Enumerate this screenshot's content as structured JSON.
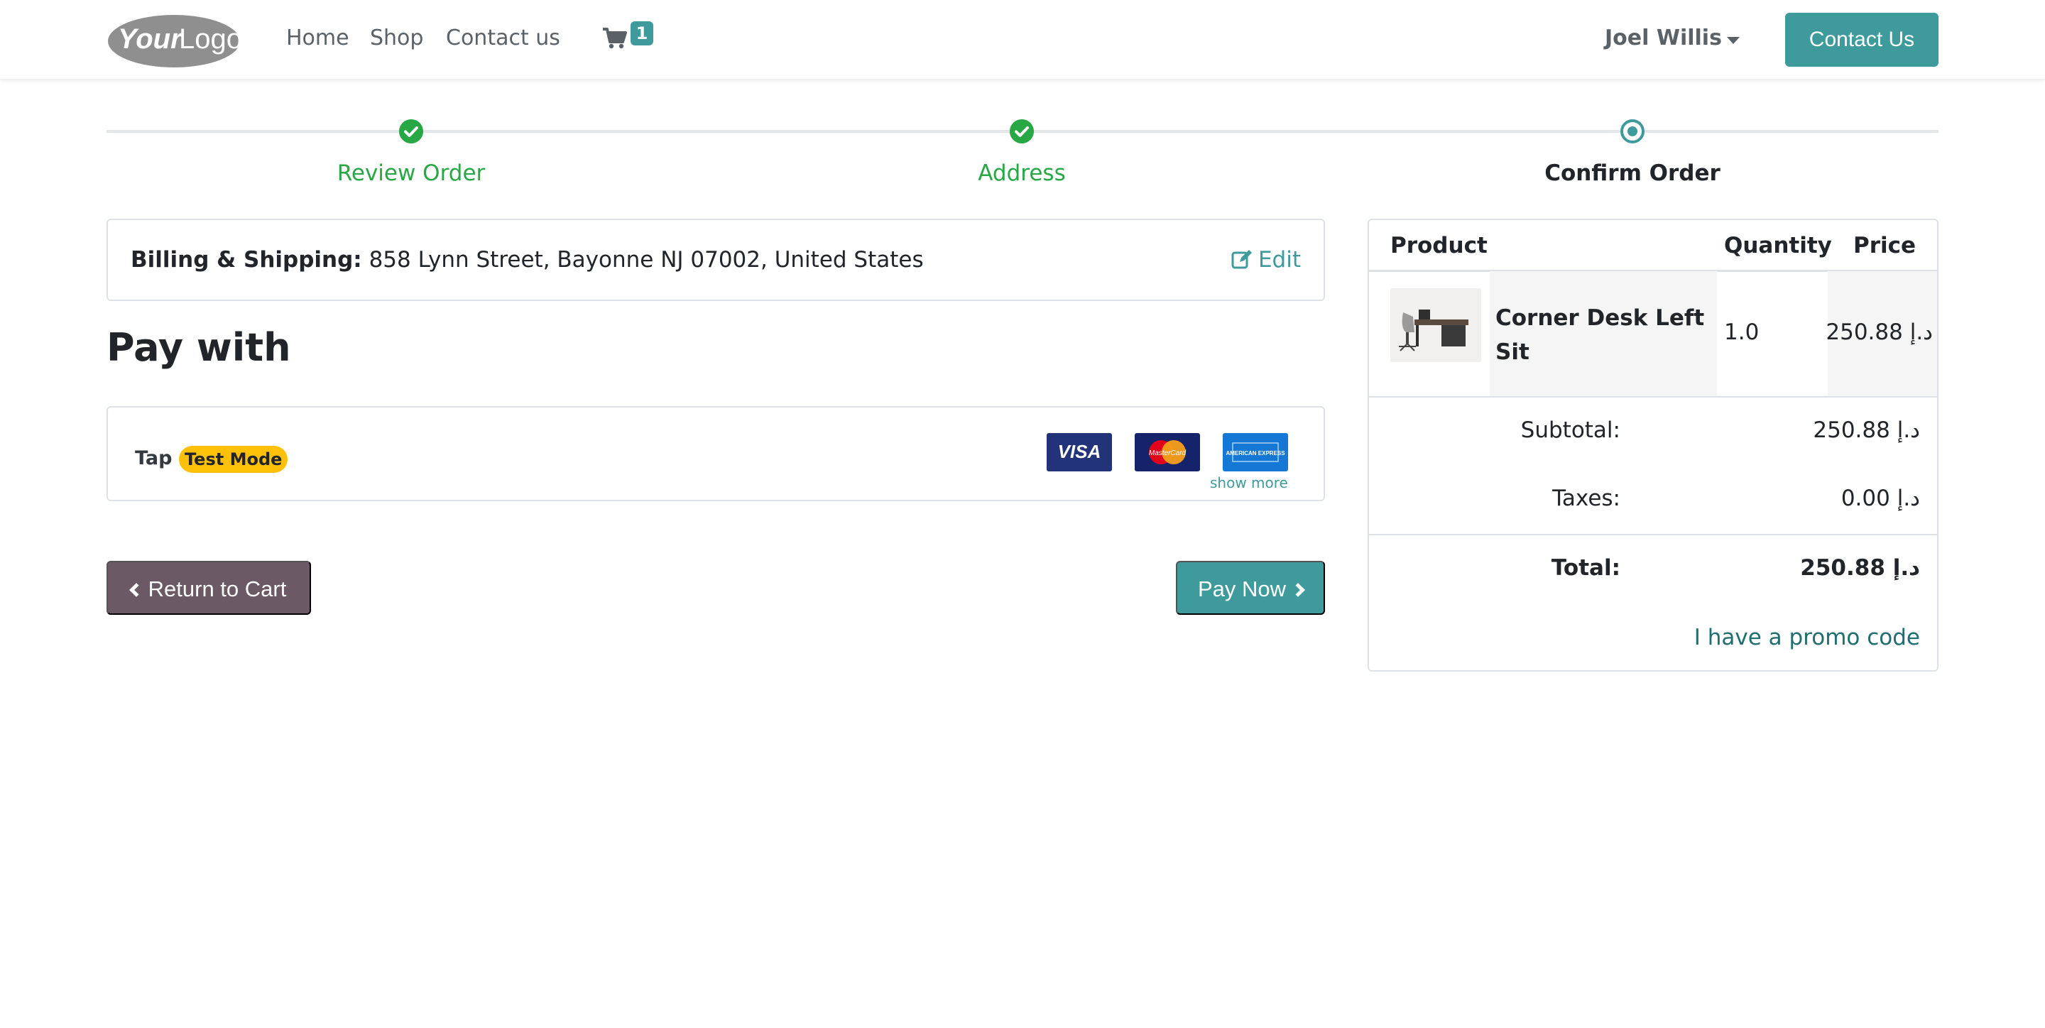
{
  "header": {
    "logo_alt": "YourLogo",
    "nav": [
      {
        "label": "Home"
      },
      {
        "label": "Shop"
      },
      {
        "label": "Contact us"
      }
    ],
    "cart_count": "1",
    "user_name": "Joel Willis",
    "contact_button": "Contact Us",
    "accent_color": "#3f9a9c"
  },
  "progress": {
    "steps": [
      {
        "label": "Review Order",
        "status": "done"
      },
      {
        "label": "Address",
        "status": "done"
      },
      {
        "label": "Confirm Order",
        "status": "current"
      }
    ]
  },
  "billing": {
    "label": "Billing & Shipping:",
    "address": "858 Lynn Street, Bayonne NJ 07002, United States",
    "edit_label": "Edit"
  },
  "payment": {
    "title": "Pay with",
    "provider": "Tap",
    "badge": "Test Mode",
    "cards": [
      "VISA",
      "MasterCard",
      "AMERICAN EXPRESS"
    ],
    "show_more": "show more"
  },
  "actions": {
    "return_label": "Return to Cart",
    "pay_label": "Pay Now"
  },
  "summary": {
    "headers": {
      "product": "Product",
      "quantity": "Quantity",
      "price": "Price"
    },
    "items": [
      {
        "name": "Corner Desk Left Sit",
        "quantity": "1.0",
        "price": "250.88 د.إ"
      }
    ],
    "subtotal_label": "Subtotal:",
    "subtotal_value": "250.88 د.إ",
    "taxes_label": "Taxes:",
    "taxes_value": "0.00 د.إ",
    "total_label": "Total:",
    "total_value": "250.88 د.إ",
    "promo_label": "I have a promo code"
  }
}
